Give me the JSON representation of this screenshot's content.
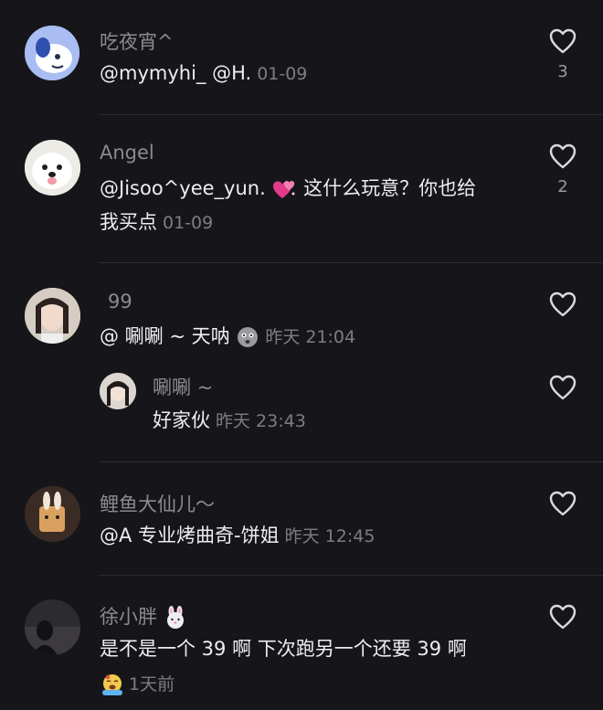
{
  "comments": [
    {
      "username": "吃夜宵^",
      "text": "@mymyhi_ @H.",
      "time": "01-09",
      "likes": "3"
    },
    {
      "username": "Angel",
      "text_line1": "@Jisoo^yee_yun.",
      "text_line1b": " 这什么玩意？你也给",
      "text_line2": "我买点",
      "time": "01-09",
      "likes": "2"
    },
    {
      "username": "99",
      "text": "@ 唰唰 ~ 天呐",
      "time": "昨天 21:04",
      "likes": ""
    },
    {
      "username": "唰唰 ~",
      "text": "好家伙",
      "time": "昨天 23:43",
      "likes": ""
    },
    {
      "username": "鲤鱼大仙儿～",
      "text": "@A 专业烤曲奇-饼姐",
      "time": "昨天 12:45",
      "likes": ""
    },
    {
      "username": "徐小胖",
      "text": "是不是一个 39 啊  下次跑另一个还要 39 啊",
      "time": "1天前",
      "likes": ""
    }
  ],
  "icons": {
    "like": "heart-outline-icon",
    "rabbit": "rabbit-emoji-icon",
    "hearts": "sparkling-hearts-emoji-icon",
    "face": "dizzy-face-emoji-icon",
    "crying": "crying-emoji-icon"
  },
  "colors": {
    "background": "#16161a",
    "username": "#8a8a92",
    "text": "#eeeef0",
    "time": "#7c7c84",
    "heart_emoji": "#e23b8a"
  }
}
